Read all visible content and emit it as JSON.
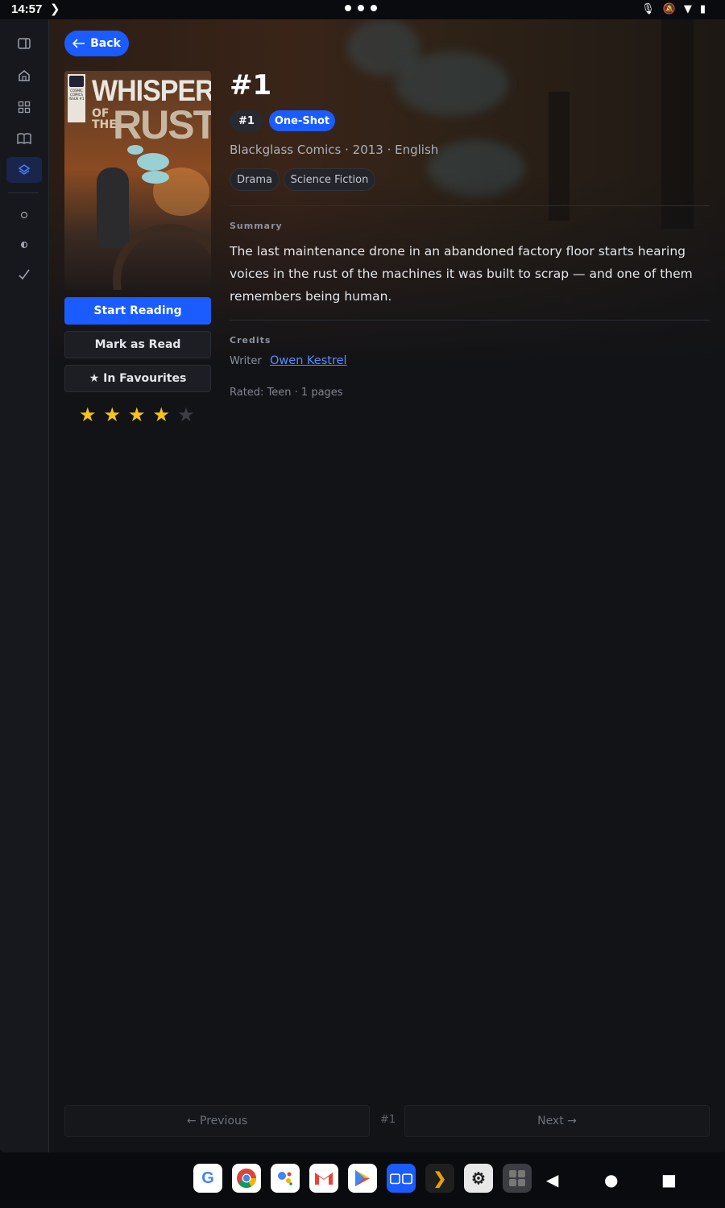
{
  "status_bar": {
    "time": "14:57"
  },
  "nav": {
    "back_label": "Back"
  },
  "book": {
    "title": "#1",
    "issue_chip": "#1",
    "format_chip": "One-Shot",
    "meta": "Blackglass Comics · 2013 · English",
    "genres": [
      "Drama",
      "Science Fiction"
    ],
    "summary_label": "Summary",
    "summary": "The last maintenance drone in an abandoned factory floor starts hearing voices in the rust of the machines it was built to scrap — and one of them remembers being human.",
    "credits_label": "Credits",
    "writer_role": "Writer",
    "writer_name": "Owen Kestrel",
    "rated": "Rated: Teen · 1 pages",
    "rating_stars": 4,
    "rating_max": 5
  },
  "cover": {
    "title_line1": "WHISPERS",
    "title_of": "OF",
    "title_the": "THE",
    "title_line2": "RUST",
    "publisher_badge": "COSMIC COMICS",
    "issue_badge": "ISSUE #1"
  },
  "actions": {
    "start_reading": "Start Reading",
    "mark_read": "Mark as Read",
    "favourites": "★ In Favourites"
  },
  "pagination": {
    "previous": "← Previous",
    "current": "#1",
    "next": "Next →"
  },
  "colors": {
    "accent": "#1a5cff",
    "star": "#f7c21a",
    "background": "#121317"
  }
}
